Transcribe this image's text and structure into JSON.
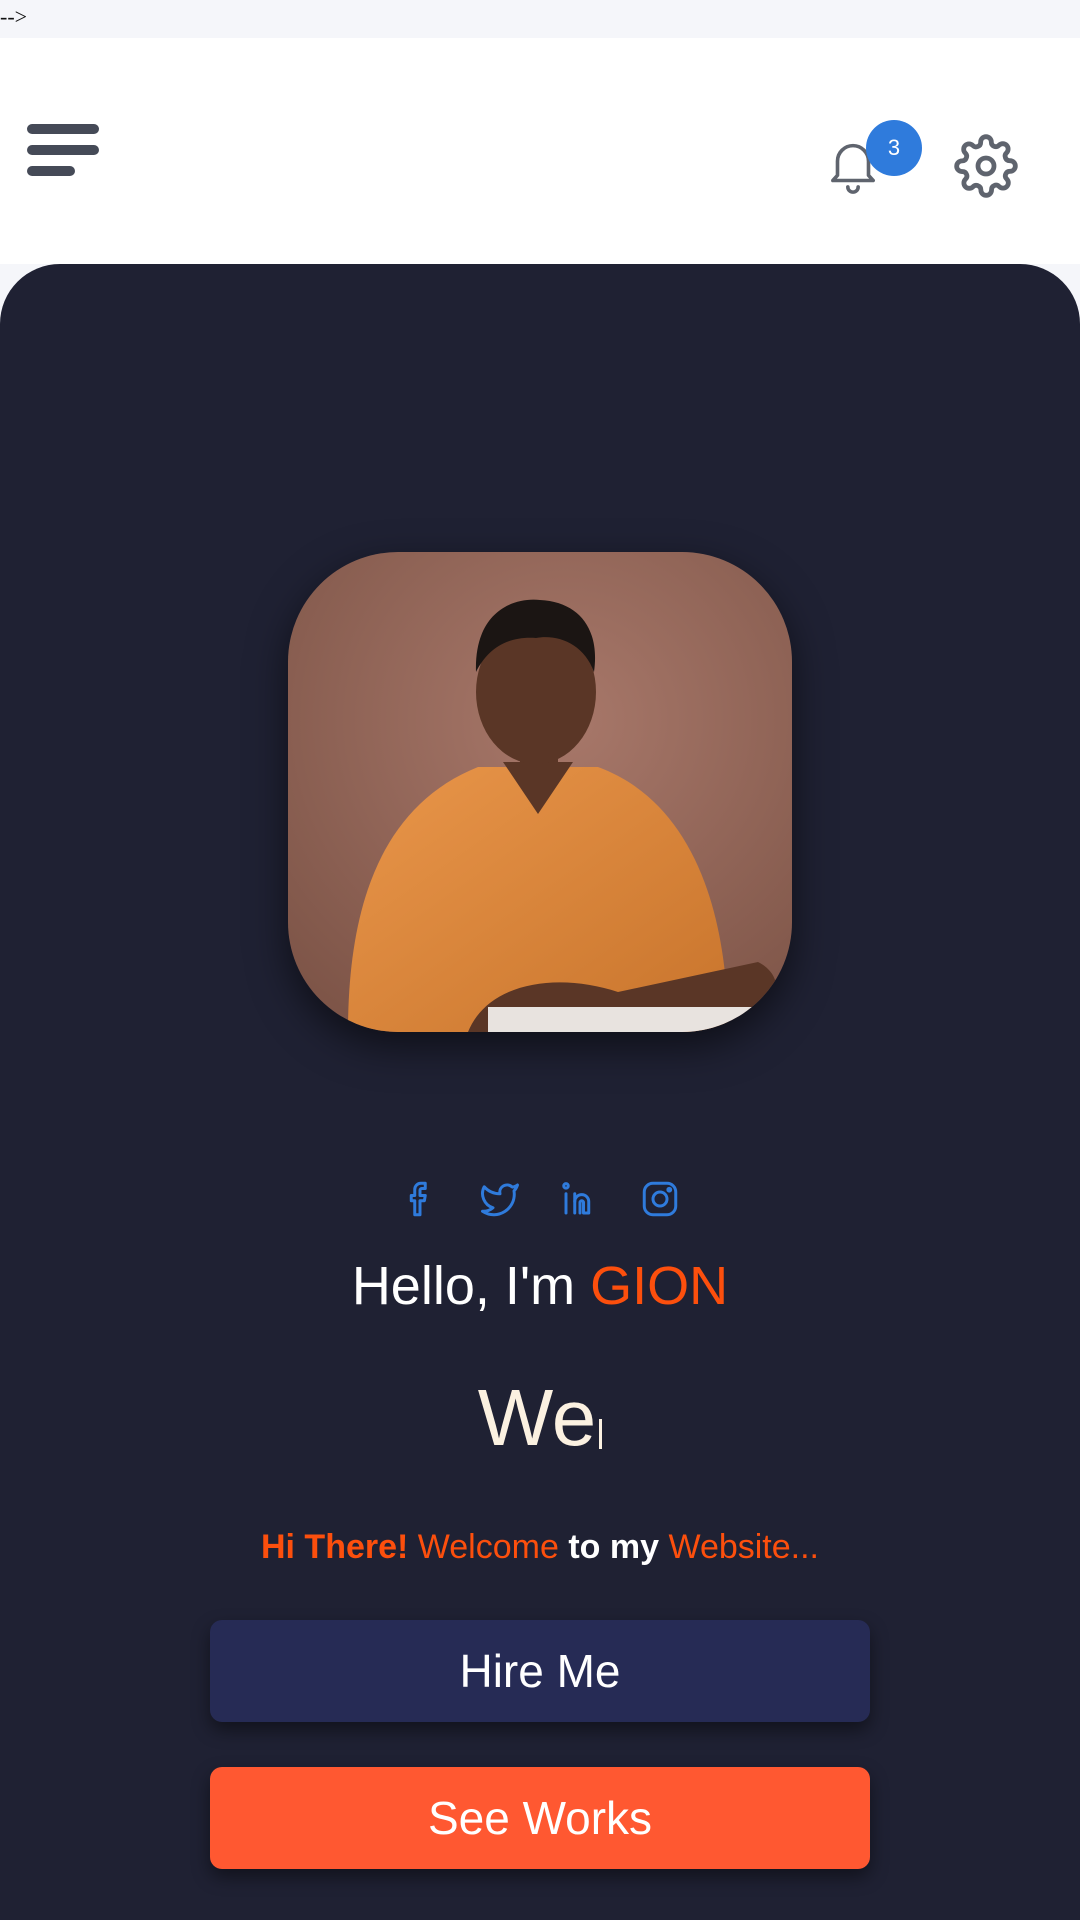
{
  "stray_text": "-->",
  "header": {
    "menu_icon": "hamburger-menu-icon",
    "notifications": {
      "icon": "bell-icon",
      "count": "3"
    },
    "settings_icon": "gear-icon"
  },
  "profile": {
    "photo_icon": "profile-photo",
    "socials": [
      {
        "icon": "facebook-icon"
      },
      {
        "icon": "twitter-icon"
      },
      {
        "icon": "linkedin-icon"
      },
      {
        "icon": "instagram-icon"
      }
    ],
    "greeting_prefix": "Hello, I'm ",
    "name": "GION",
    "typed_text": "We",
    "welcome": {
      "part1": "Hi There!",
      "part2": " Welcome ",
      "part3": "to my",
      "part4": " Website..."
    }
  },
  "actions": {
    "hire_label": "Hire Me",
    "works_label": "See Works"
  },
  "colors": {
    "accent": "#fc4f0d",
    "page_background": "#1f2133",
    "badge": "#2f7bdc",
    "hire_button": "#262b55",
    "works_button": "#ff5831",
    "social_icons": "#2f7bdc"
  }
}
